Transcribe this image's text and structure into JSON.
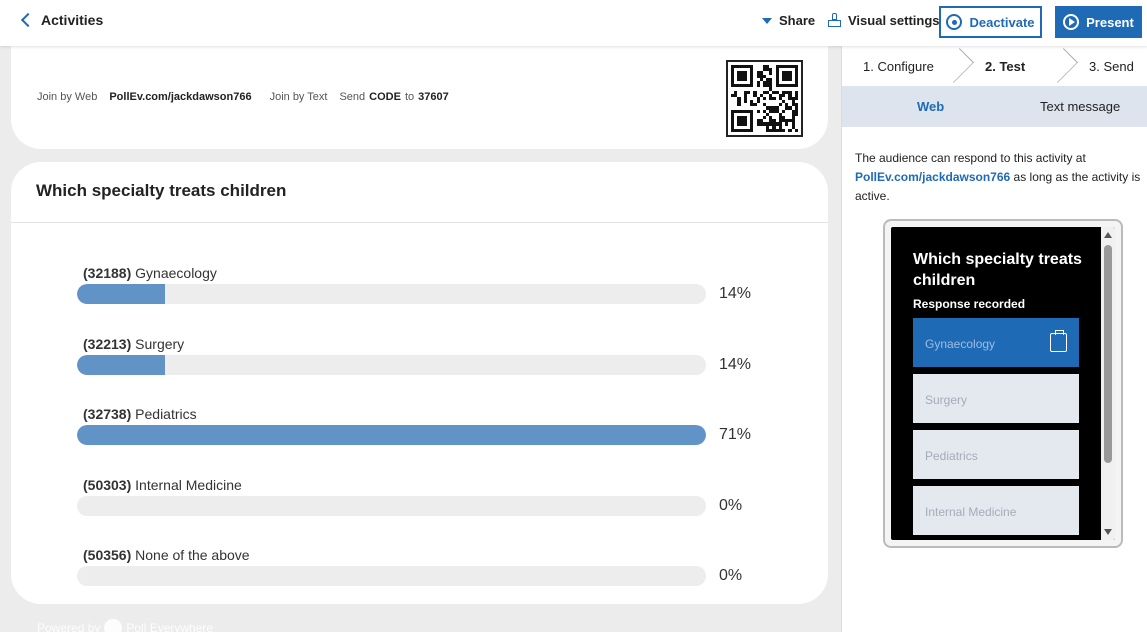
{
  "topbar": {
    "back_label": "Activities",
    "share_label": "Share",
    "visual_settings_label": "Visual settings",
    "deactivate_label": "Deactivate",
    "present_label": "Present"
  },
  "join": {
    "web_prefix": "Join by Web",
    "web_url": "PollEv.com/jackdawson766",
    "text_prefix": "Join by Text",
    "send_word": "Send",
    "code_word": "CODE",
    "to_word": "to",
    "number": "37607"
  },
  "question": {
    "title": "Which specialty treats children",
    "options": [
      {
        "code": "(32188)",
        "label": "Gynaecology",
        "percent_text": "14%",
        "percent": 14
      },
      {
        "code": "(32213)",
        "label": "Surgery",
        "percent_text": "14%",
        "percent": 14
      },
      {
        "code": "(32738)",
        "label": "Pediatrics",
        "percent_text": "71%",
        "percent": 100
      },
      {
        "code": "(50303)",
        "label": "Internal Medicine",
        "percent_text": "0%",
        "percent": 0
      },
      {
        "code": "(50356)",
        "label": "None of the above",
        "percent_text": "0%",
        "percent": 0
      }
    ]
  },
  "footer": {
    "powered_by": "Powered by",
    "brand": "Poll Everywhere"
  },
  "panel": {
    "steps": [
      "1. Configure",
      "2. Test",
      "3. Send"
    ],
    "active_step": "2. Test",
    "tabs": {
      "web": "Web",
      "text": "Text message"
    },
    "info_prefix": "The audience can respond to this activity at",
    "info_url": "PollEv.com/jackdawson766",
    "info_suffix": "as long as the activity is active.",
    "phone": {
      "title": "Which specialty treats children",
      "status": "Response recorded",
      "options": [
        "Gynaecology",
        "Surgery",
        "Pediatrics",
        "Internal Medicine"
      ],
      "selected": "Gynaecology"
    }
  },
  "colors": {
    "accent": "#1f6ab5",
    "bar_fill": "#6193c7",
    "bar_track": "#ededed",
    "background": "#ececec"
  }
}
